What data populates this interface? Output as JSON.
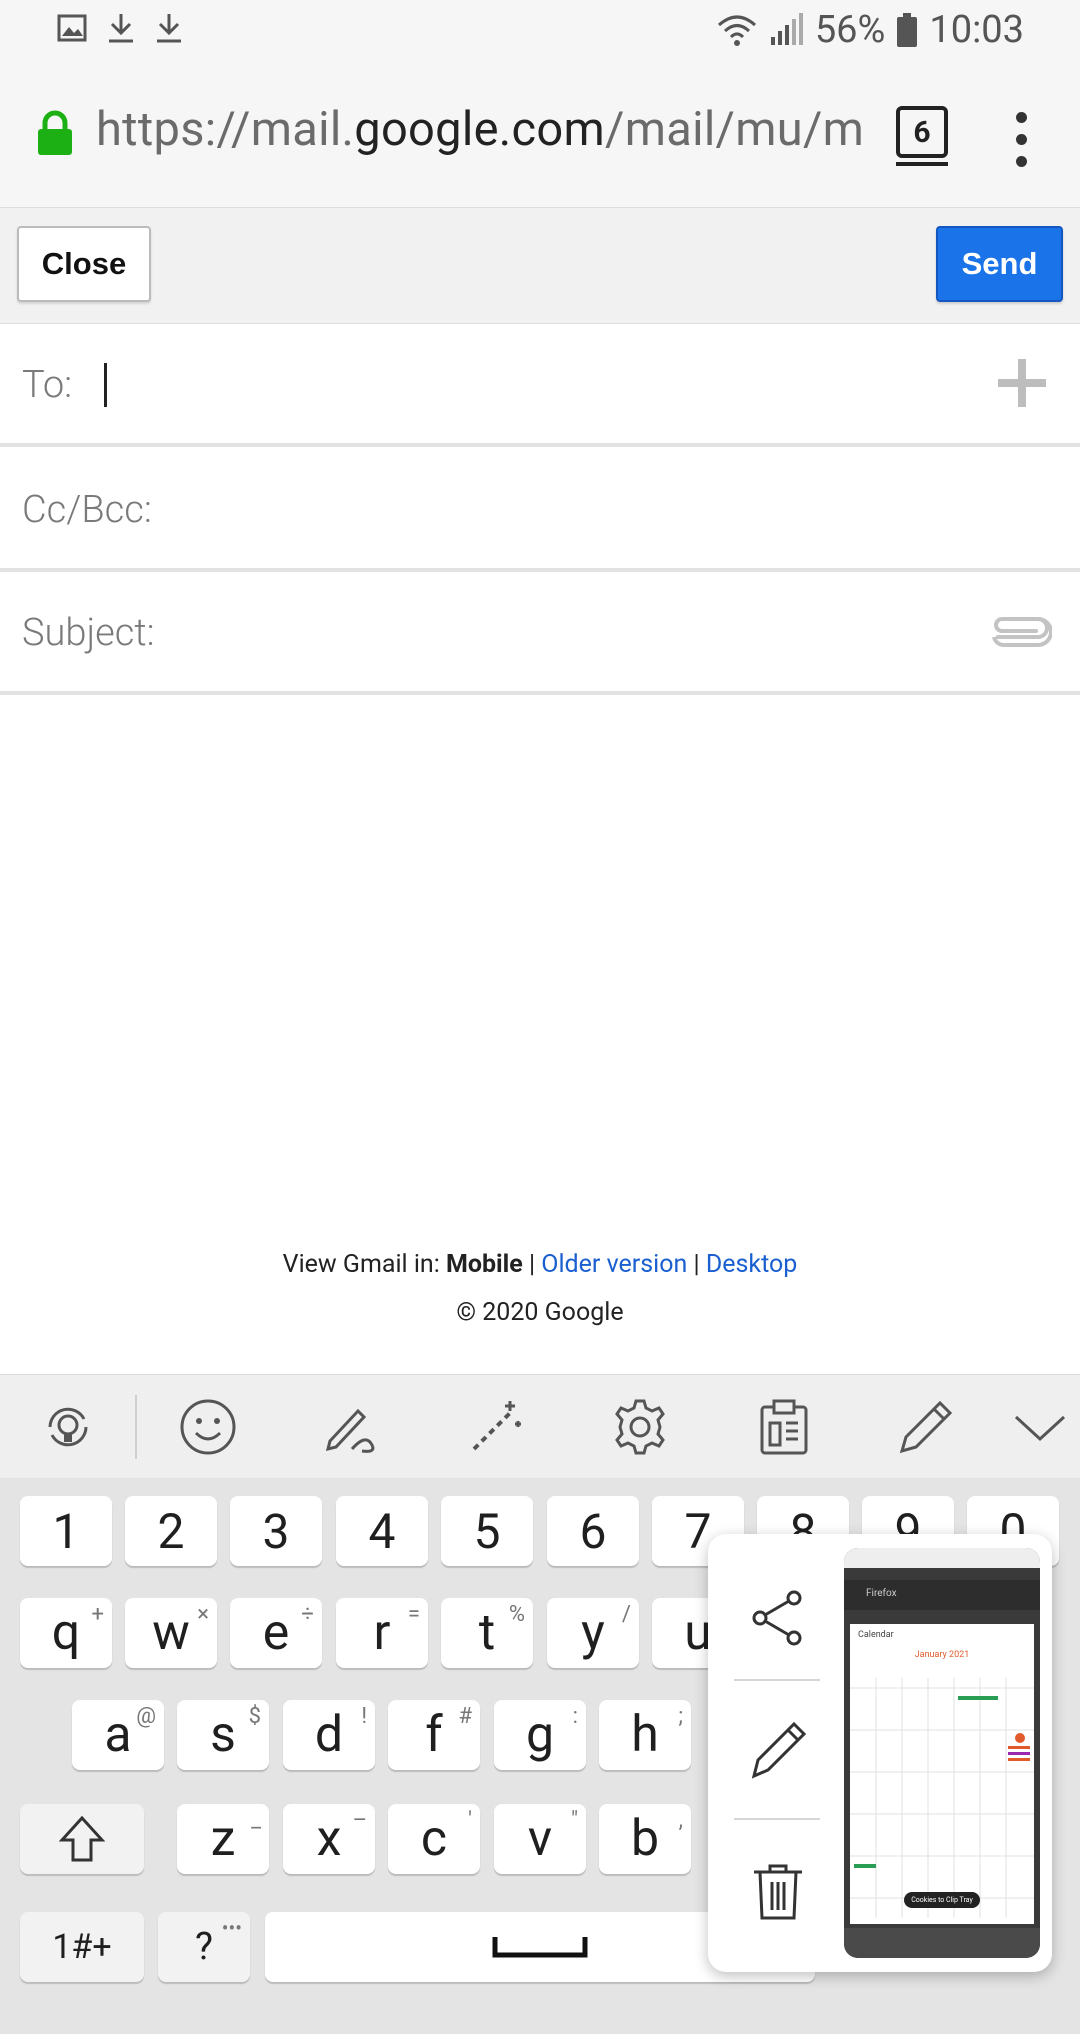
{
  "status_bar": {
    "battery_percent": "56%",
    "time": "10:03",
    "left_icons": [
      "image-icon",
      "download-icon",
      "download-icon"
    ],
    "right_icons": [
      "wifi-icon",
      "signal-icon",
      "battery-icon"
    ]
  },
  "browser": {
    "url_host_prefix": "https://mail.",
    "url_host_main": "google.com",
    "url_path": "/mail/mu/mp/",
    "tab_count": "6"
  },
  "compose": {
    "close_label": "Close",
    "send_label": "Send",
    "to_label": "To:",
    "cc_label": "Cc/Bcc:",
    "subject_label": "Subject:"
  },
  "footer": {
    "view_in": "View Gmail in:",
    "mobile": "Mobile",
    "sep1": "|",
    "older": "Older version",
    "sep2": "|",
    "desktop": "Desktop",
    "copyright": "© 2020 Google"
  },
  "keyboard": {
    "number_row": [
      "1",
      "2",
      "3",
      "4",
      "5",
      "6",
      "7",
      "8",
      "9",
      "0"
    ],
    "row1": [
      {
        "k": "q",
        "s": "+"
      },
      {
        "k": "w",
        "s": "×"
      },
      {
        "k": "e",
        "s": "÷"
      },
      {
        "k": "r",
        "s": "="
      },
      {
        "k": "t",
        "s": "%"
      },
      {
        "k": "y",
        "s": "/"
      },
      {
        "k": "u",
        "s": ""
      }
    ],
    "row2": [
      {
        "k": "a",
        "s": "@"
      },
      {
        "k": "s",
        "s": "$"
      },
      {
        "k": "d",
        "s": "!"
      },
      {
        "k": "f",
        "s": "#"
      },
      {
        "k": "g",
        "s": ":"
      },
      {
        "k": "h",
        "s": ";"
      }
    ],
    "row3": [
      {
        "k": "z",
        "s": "_"
      },
      {
        "k": "x",
        "s": "–"
      },
      {
        "k": "c",
        "s": "'"
      },
      {
        "k": "v",
        "s": "\""
      },
      {
        "k": "b",
        "s": ","
      }
    ],
    "symbols_key": "1#+",
    "question_key": "?",
    "question_sub": "•••"
  },
  "screenshot_popup": {
    "thumb_title": "January 2021",
    "thumb_app": "Calendar",
    "thumb_browser": "Firefox",
    "thumb_pill": "Cookies to Clip Tray"
  }
}
